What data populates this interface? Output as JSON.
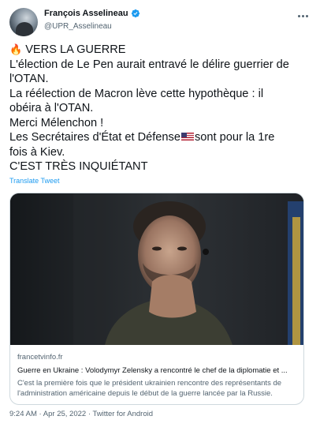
{
  "author": {
    "name": "François Asselineau",
    "handle": "@UPR_Asselineau"
  },
  "tweet": {
    "lines": [
      "VERS LA GUERRE",
      "L'élection de Le Pen aurait entravé le délire guerrier de",
      "l'OTAN.",
      "La réélection de Macron lève cette hypothèque : il",
      "obéira à l'OTAN.",
      "Merci Mélenchon !",
      "Les Secrétaires d'État et Défense",
      "sont pour la 1re",
      "fois à Kiev.",
      "C'EST TRÈS INQUIÉTANT"
    ],
    "translate_label": "Translate Tweet"
  },
  "card": {
    "domain": "francetvinfo.fr",
    "title": "Guerre en Ukraine : Volodymyr Zelensky a rencontré le chef de la diplomatie et ...",
    "description": "C'est la première fois que le président ukrainien rencontre des représentants de l'administration américaine depuis le début de la guerre lancée par la Russie."
  },
  "footer": {
    "meta": "9:24 AM · Apr 25, 2022 · Twitter for Android"
  },
  "colors": {
    "accent": "#1d9bf0",
    "muted": "#536471",
    "border": "#cfd9de"
  },
  "icons": [
    "fire-emoji",
    "verified-badge-icon",
    "more-options-icon",
    "us-flag-emoji"
  ]
}
